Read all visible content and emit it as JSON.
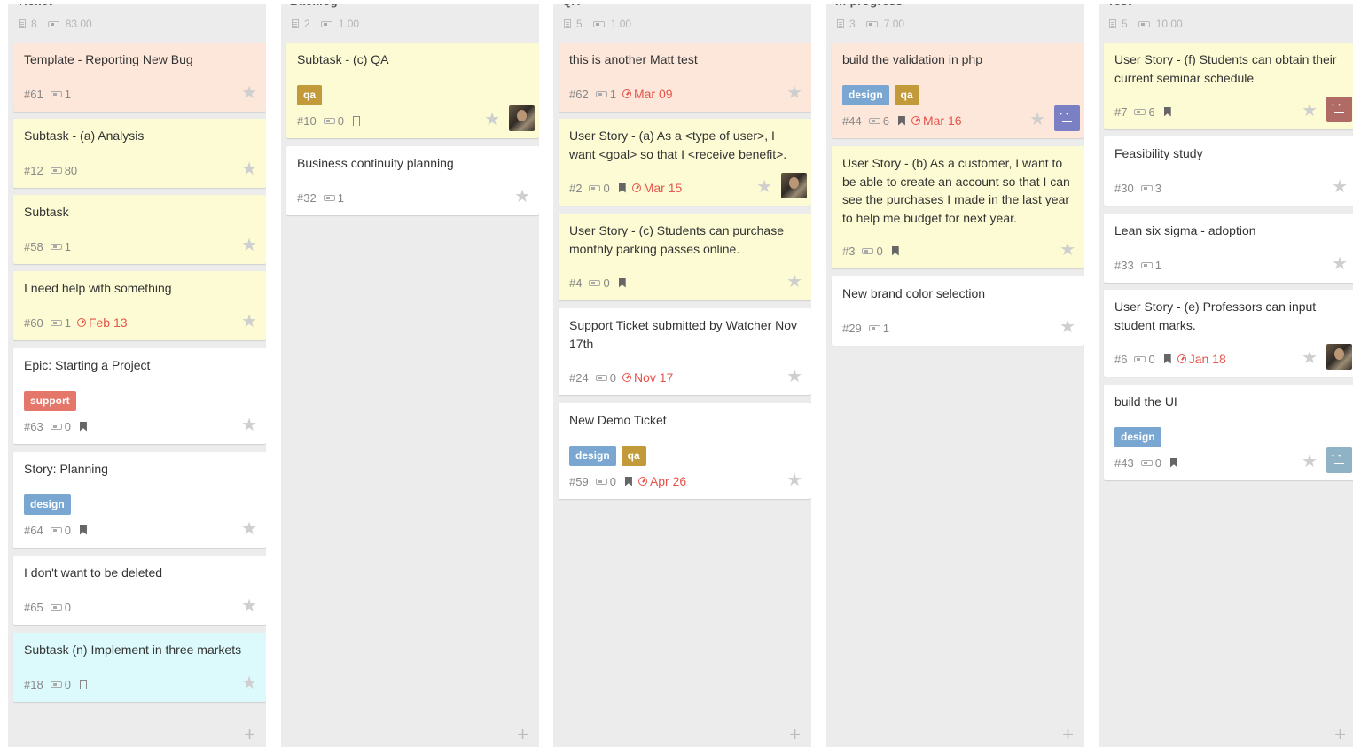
{
  "columns": [
    {
      "title": "Ticket",
      "count": "8",
      "points": "83.00",
      "cards": [
        {
          "title": "Template - Reporting New Bug",
          "ref": "#61",
          "pts": "1",
          "color": "peach"
        },
        {
          "title": "Subtask - (a) Analysis",
          "ref": "#12",
          "pts": "80",
          "color": "yellow"
        },
        {
          "title": "Subtask",
          "ref": "#58",
          "pts": "1",
          "color": "yellow"
        },
        {
          "title": "I need help with something",
          "ref": "#60",
          "pts": "1",
          "due": "Feb 13",
          "color": "yellow"
        },
        {
          "title": "Epic: Starting a Project",
          "ref": "#63",
          "pts": "0",
          "tags": [
            "support"
          ],
          "bookmark": "filled",
          "color": "white"
        },
        {
          "title": "Story: Planning",
          "ref": "#64",
          "pts": "0",
          "tags": [
            "design"
          ],
          "bookmark": "filled",
          "color": "white"
        },
        {
          "title": "I don't want to be deleted",
          "ref": "#65",
          "pts": "0",
          "color": "white"
        },
        {
          "title": "Subtask (n) Implement in three markets",
          "ref": "#18",
          "pts": "0",
          "bookmark": "hollow",
          "color": "cyan"
        }
      ]
    },
    {
      "title": "Backlog",
      "count": "2",
      "points": "1.00",
      "cards": [
        {
          "title": "Subtask - (c) QA",
          "ref": "#10",
          "pts": "0",
          "tags": [
            "qa"
          ],
          "bookmark": "hollow",
          "avatar": "photo",
          "color": "yellow"
        },
        {
          "title": "Business continuity planning",
          "ref": "#32",
          "pts": "1",
          "color": "white"
        }
      ]
    },
    {
      "title": "QA",
      "count": "5",
      "points": "1.00",
      "cards": [
        {
          "title": "this is another Matt test",
          "ref": "#62",
          "pts": "1",
          "due": "Mar 09",
          "color": "peach"
        },
        {
          "title": "User Story - (a) As a <type of user>, I want <goal> so that I <receive benefit>.",
          "ref": "#2",
          "pts": "0",
          "bookmark": "filled",
          "due": "Mar 15",
          "avatar": "photo",
          "color": "yellow"
        },
        {
          "title": "User Story - (c) Students can purchase monthly parking passes online.",
          "ref": "#4",
          "pts": "0",
          "bookmark": "filled",
          "color": "yellow"
        },
        {
          "title": "Support Ticket submitted by Watcher Nov 17th",
          "ref": "#24",
          "pts": "0",
          "due": "Nov 17",
          "color": "white"
        },
        {
          "title": "New Demo Ticket",
          "ref": "#59",
          "pts": "0",
          "tags": [
            "design",
            "qa"
          ],
          "bookmark": "filled",
          "due": "Apr 26",
          "color": "white"
        }
      ]
    },
    {
      "title": "In progress",
      "count": "3",
      "points": "7.00",
      "cards": [
        {
          "title": "build the validation in php",
          "ref": "#44",
          "pts": "6",
          "tags": [
            "design",
            "qa"
          ],
          "bookmark": "filled",
          "due": "Mar 16",
          "avatar": "purple",
          "color": "peach"
        },
        {
          "title": "User Story - (b) As a customer, I want to be able to create an account so that I can see the purchases I made in the last year to help me budget for next year.",
          "ref": "#3",
          "pts": "0",
          "bookmark": "filled",
          "color": "yellow"
        },
        {
          "title": "New brand color selection",
          "ref": "#29",
          "pts": "1",
          "color": "white"
        }
      ]
    },
    {
      "title": "Test",
      "count": "5",
      "points": "10.00",
      "cards": [
        {
          "title": "User Story - (f) Students can obtain their current seminar schedule",
          "ref": "#7",
          "pts": "6",
          "bookmark": "filled",
          "avatar": "brown",
          "color": "yellow"
        },
        {
          "title": "Feasibility study",
          "ref": "#30",
          "pts": "3",
          "color": "white"
        },
        {
          "title": "Lean six sigma - adoption",
          "ref": "#33",
          "pts": "1",
          "color": "white"
        },
        {
          "title": "User Story - (e) Professors can input student marks.",
          "ref": "#6",
          "pts": "0",
          "bookmark": "filled",
          "due": "Jan 18",
          "avatar": "photo",
          "color": "white"
        },
        {
          "title": "build the UI",
          "ref": "#43",
          "pts": "0",
          "tags": [
            "design"
          ],
          "bookmark": "filled",
          "avatar": "teal",
          "color": "white"
        }
      ]
    }
  ],
  "tag_labels": {
    "support": "support",
    "design": "design",
    "qa": "qa"
  },
  "colors": {
    "support": "#e5766a",
    "design": "#7aa7d2",
    "qa": "#c29a39",
    "due": "#e5534b"
  }
}
